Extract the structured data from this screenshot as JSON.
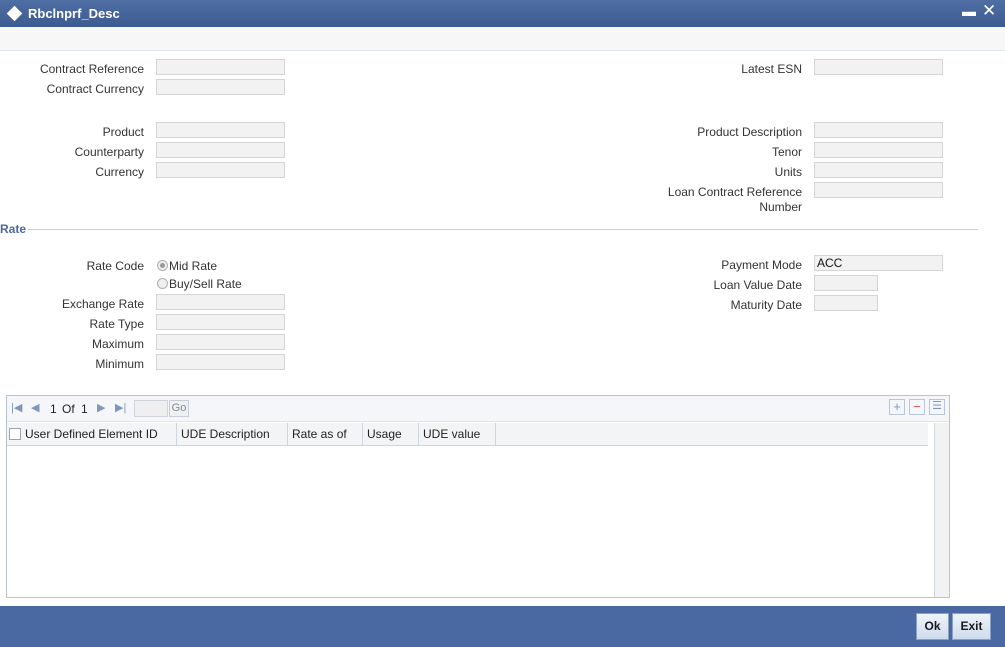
{
  "window": {
    "title": "Rbclnprf_Desc"
  },
  "labels": {
    "contract_reference": "Contract Reference",
    "contract_currency": "Contract Currency",
    "latest_esn": "Latest ESN",
    "product": "Product",
    "counterparty": "Counterparty",
    "currency": "Currency",
    "product_description": "Product Description",
    "tenor": "Tenor",
    "units": "Units",
    "loan_contract_reference_1": "Loan Contract Reference",
    "loan_contract_reference_2": "Number"
  },
  "rate_section": {
    "title": "Rate",
    "rate_code_label": "Rate Code",
    "mid_rate_label": "Mid Rate",
    "buy_sell_rate_label": "Buy/Sell Rate",
    "exchange_rate_label": "Exchange Rate",
    "rate_type_label": "Rate Type",
    "maximum_label": "Maximum",
    "minimum_label": "Minimum",
    "payment_mode_label": "Payment Mode",
    "payment_mode_value": "ACC",
    "loan_value_date_label": "Loan Value Date",
    "maturity_date_label": "Maturity Date"
  },
  "grid": {
    "pager": {
      "current": "1",
      "of_label": "Of",
      "total": "1",
      "go_label": "Go"
    },
    "columns": [
      "User Defined Element ID",
      "UDE Description",
      "Rate as of",
      "Usage",
      "UDE value"
    ],
    "rows": []
  },
  "footer": {
    "ok_label": "Ok",
    "exit_label": "Exit"
  }
}
